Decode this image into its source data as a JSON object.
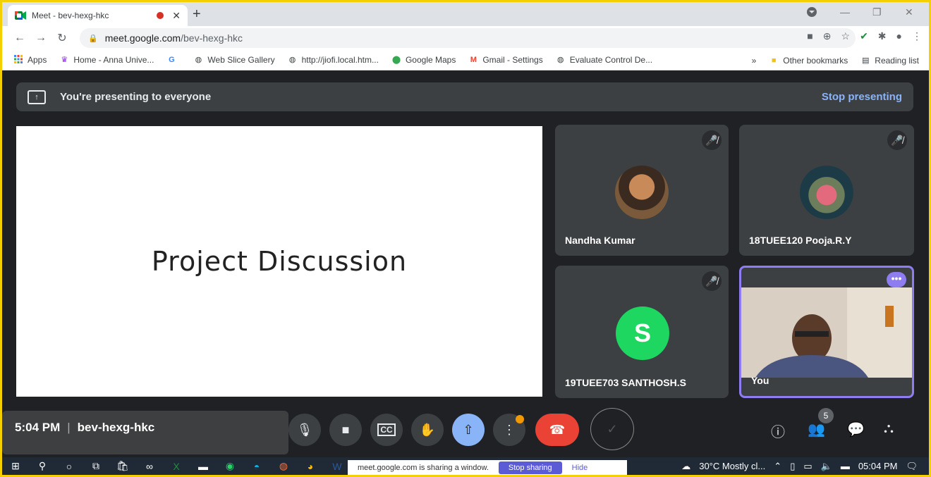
{
  "browser": {
    "tab_title": "Meet - bev-hexg-hkc",
    "url_host": "meet.google.com",
    "url_path": "/bev-hexg-hkc"
  },
  "bookmarks": {
    "items": [
      {
        "label": "Apps",
        "icon": "apps-grid-icon"
      },
      {
        "label": "Home - Anna Unive...",
        "icon": "anna-univ-icon"
      },
      {
        "label": "",
        "icon": "google-g-icon"
      },
      {
        "label": "Web Slice Gallery",
        "icon": "globe-icon"
      },
      {
        "label": "http://jiofi.local.htm...",
        "icon": "globe-icon"
      },
      {
        "label": "Google Maps",
        "icon": "maps-pin-icon"
      },
      {
        "label": "Gmail - Settings",
        "icon": "gmail-icon"
      },
      {
        "label": "Evaluate Control De...",
        "icon": "globe-icon"
      }
    ],
    "overflow": "»",
    "other": "Other bookmarks",
    "reading": "Reading list"
  },
  "banner": {
    "text": "You're presenting to everyone",
    "stop": "Stop presenting"
  },
  "slide": {
    "title": "Project Discussion"
  },
  "participants": [
    {
      "name": "Nandha Kumar"
    },
    {
      "name": "18TUEE120 Pooja.R.Y"
    },
    {
      "name": "19TUEE703 SANTHOSH.S",
      "initial": "S"
    },
    {
      "name": "You"
    }
  ],
  "meeting": {
    "time": "5:04 PM",
    "code": "bev-hexg-hkc",
    "people_count": "5"
  },
  "taskbar": {
    "share_text": "meet.google.com is sharing a window.",
    "stop_sharing": "Stop sharing",
    "hide": "Hide",
    "weather": "30°C  Mostly cl...",
    "clock": "05:04 PM"
  },
  "colors": {
    "frame_border": "#f5d000",
    "meet_bg": "#202124",
    "accent_purple": "#8e7cf1",
    "hangup_red": "#ea4335",
    "link_blue": "#8ab4f8",
    "avatar_green": "#1ed760"
  }
}
